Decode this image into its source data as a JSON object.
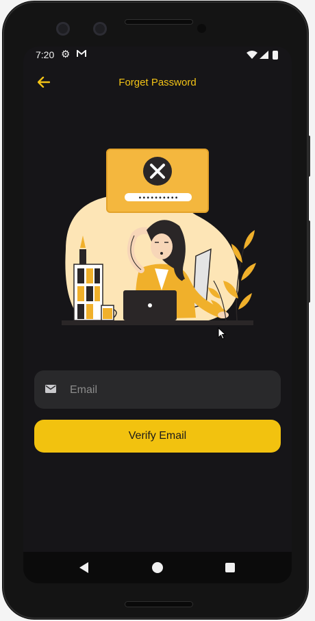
{
  "status_bar": {
    "time": "7:20",
    "settings_icon": "gear-icon",
    "mail_icon": "gmail-icon",
    "wifi_icon": "wifi-icon",
    "signal_icon": "signal-icon",
    "battery_icon": "battery-icon"
  },
  "app_bar": {
    "back_icon": "arrow-left-icon",
    "title": "Forget Password"
  },
  "illustration": {
    "popup_icon": "close-x-icon",
    "password_mask": "••••••••••"
  },
  "form": {
    "email_icon": "mail-icon",
    "email_placeholder": "Email",
    "email_value": "",
    "verify_label": "Verify Email"
  },
  "nav_bar": {
    "back_icon": "triangle-back-icon",
    "home_icon": "circle-home-icon",
    "recents_icon": "square-recents-icon"
  },
  "colors": {
    "accent": "#f3c316",
    "background": "#161518",
    "field": "#29292b",
    "button": "#f2c20f"
  }
}
